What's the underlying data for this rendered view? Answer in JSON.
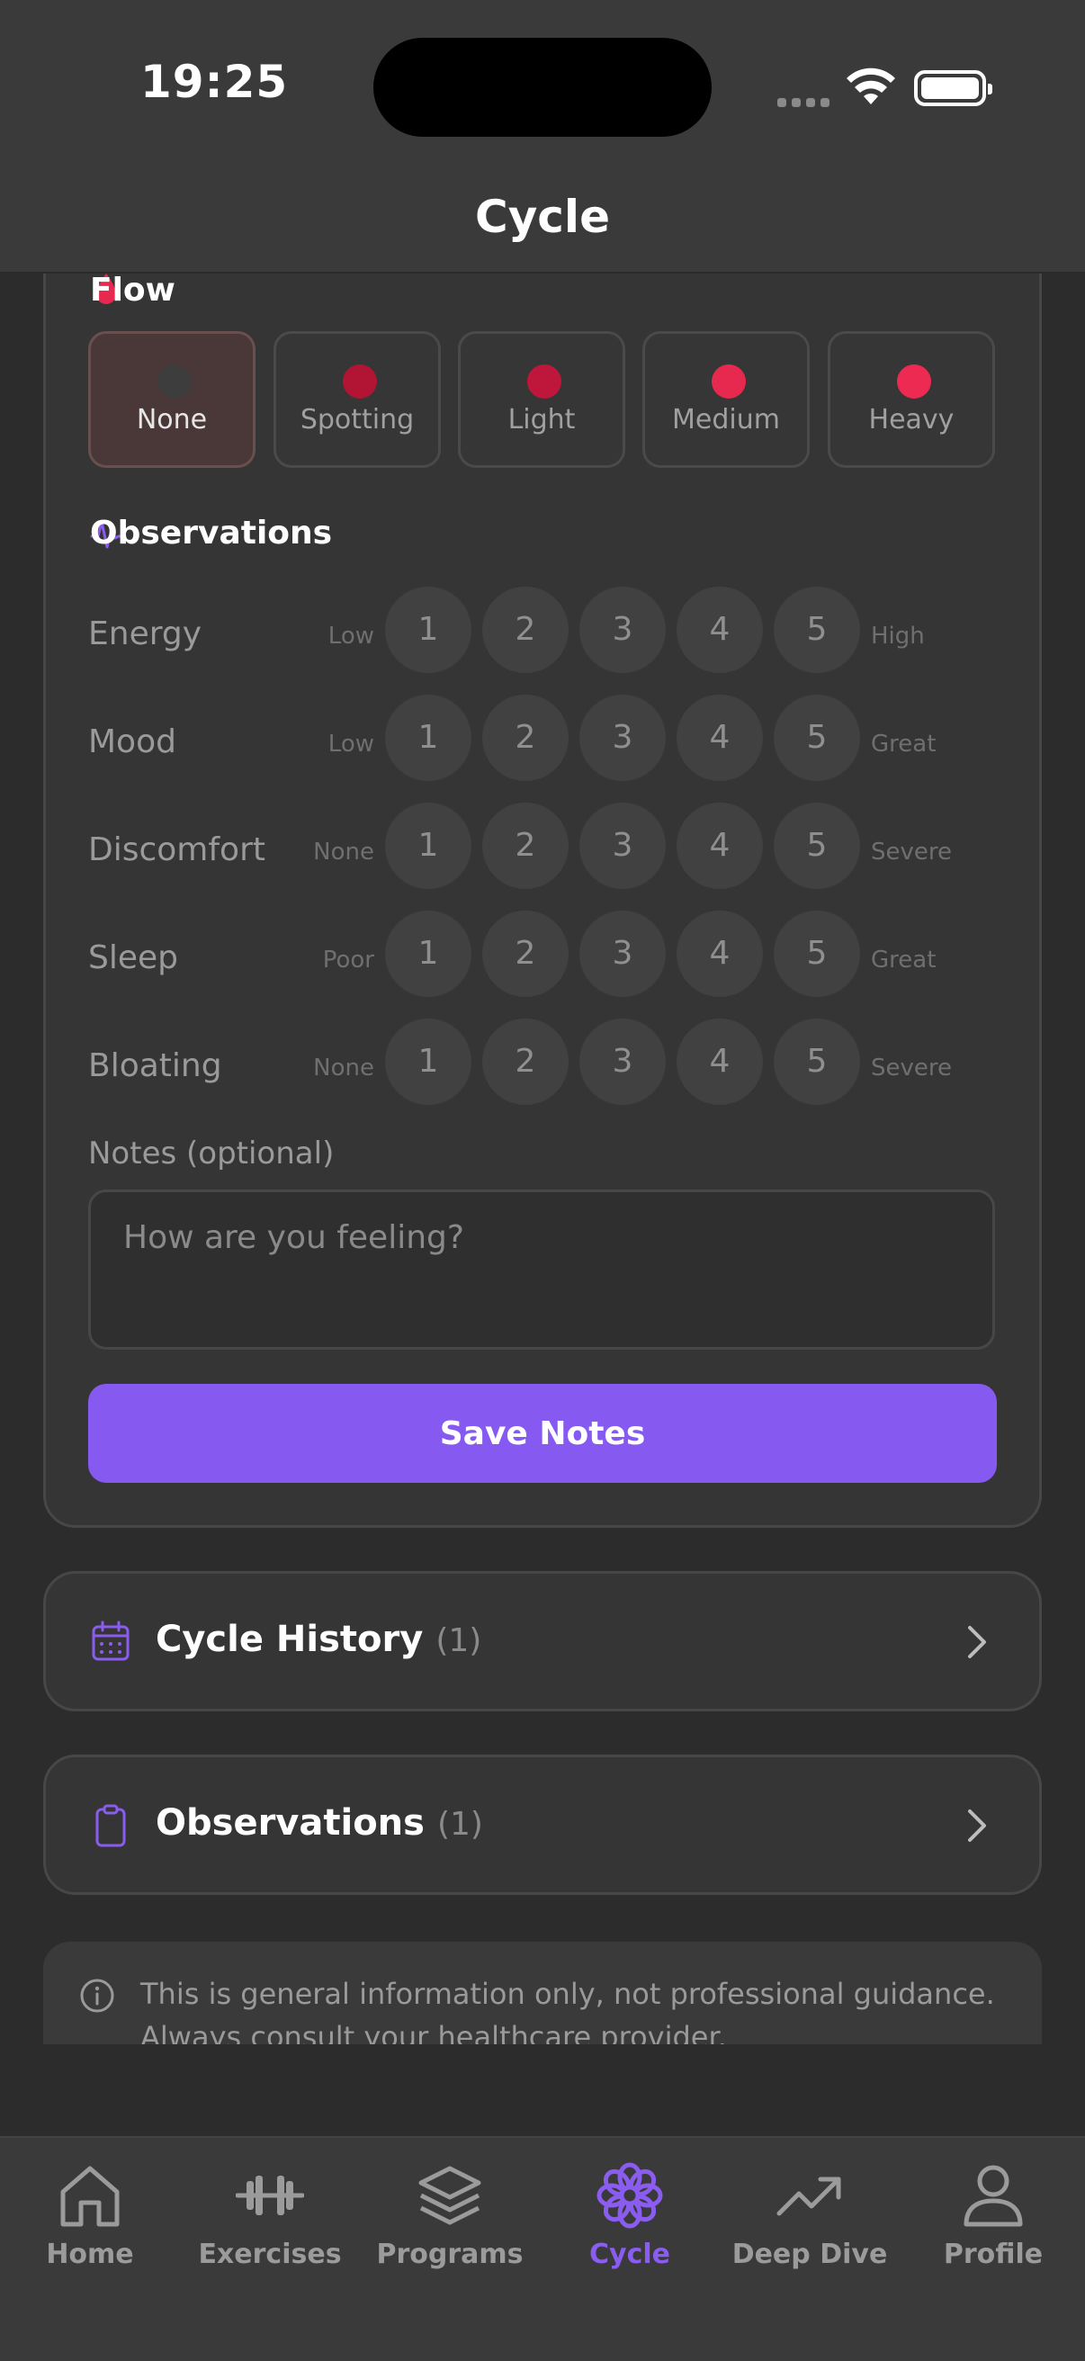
{
  "status_bar": {
    "time": "19:25"
  },
  "header": {
    "title": "Cycle"
  },
  "flow": {
    "heading": "Flow",
    "options": [
      {
        "label": "None",
        "color": "#3d3d3d",
        "selected": true
      },
      {
        "label": "Spotting",
        "color": "#b21434"
      },
      {
        "label": "Light",
        "color": "#be173b"
      },
      {
        "label": "Medium",
        "color": "#e8294f"
      },
      {
        "label": "Heavy",
        "color": "#ec2a52"
      }
    ]
  },
  "observations": {
    "heading": "Observations",
    "scale": [
      "1",
      "2",
      "3",
      "4",
      "5"
    ],
    "rows": [
      {
        "name": "Energy",
        "low": "Low",
        "high": "High"
      },
      {
        "name": "Mood",
        "low": "Low",
        "high": "Great"
      },
      {
        "name": "Discomfort",
        "low": "None",
        "high": "Severe"
      },
      {
        "name": "Sleep",
        "low": "Poor",
        "high": "Great"
      },
      {
        "name": "Bloating",
        "low": "None",
        "high": "Severe"
      }
    ]
  },
  "notes": {
    "label": "Notes (optional)",
    "placeholder": "How are you feeling?",
    "save_label": "Save Notes"
  },
  "cycle_history": {
    "title": "Cycle History",
    "count": "(1)"
  },
  "observations_link": {
    "title": "Observations",
    "count": "(1)"
  },
  "disclaimer": "This is general information only, not professional guidance. Always consult your healthcare provider.",
  "tabs": [
    {
      "label": "Home"
    },
    {
      "label": "Exercises"
    },
    {
      "label": "Programs"
    },
    {
      "label": "Cycle",
      "active": true
    },
    {
      "label": "Deep Dive"
    },
    {
      "label": "Profile"
    }
  ],
  "colors": {
    "accent": "#8659f0",
    "flow_icon": "#e8294f"
  }
}
